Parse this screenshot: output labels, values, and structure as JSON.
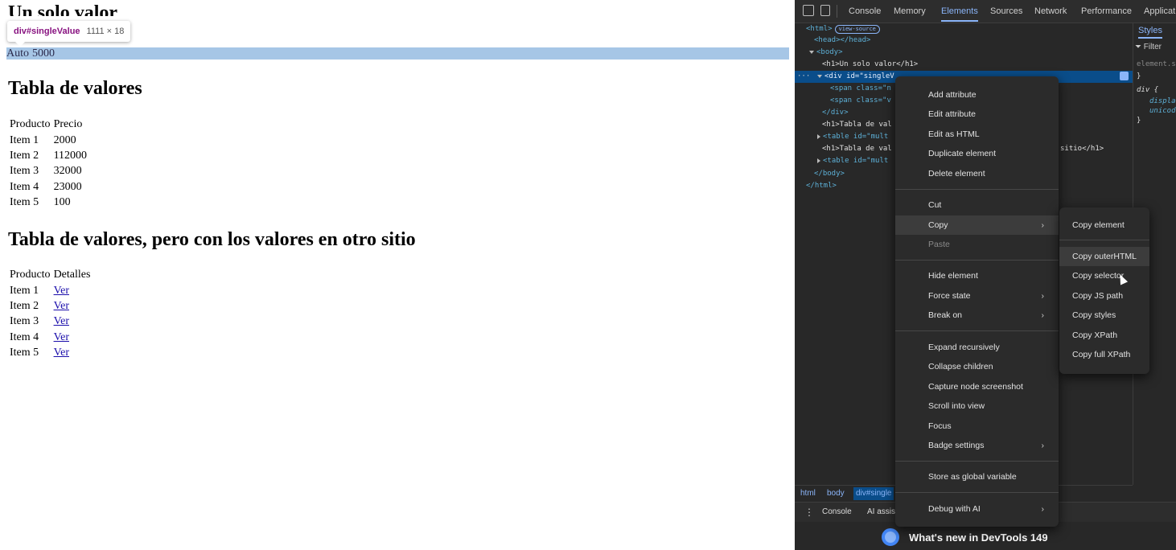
{
  "page": {
    "h1_single": "Un solo valor",
    "single_value": {
      "label": "Auto",
      "value": "5000"
    },
    "tooltip": {
      "selector": "div#singleValue",
      "size": "1111 × 18"
    },
    "h1_table1": "Tabla de valores",
    "table1": {
      "headers": [
        "Producto",
        "Precio"
      ],
      "rows": [
        [
          "Item 1",
          "2000"
        ],
        [
          "Item 2",
          "112000"
        ],
        [
          "Item 3",
          "32000"
        ],
        [
          "Item 4",
          "23000"
        ],
        [
          "Item 5",
          "100"
        ]
      ]
    },
    "h1_table2": "Tabla de valores, pero con los valores en otro sitio",
    "table2": {
      "headers": [
        "Producto",
        "Detalles"
      ],
      "rows": [
        [
          "Item 1",
          "Ver"
        ],
        [
          "Item 2",
          "Ver"
        ],
        [
          "Item 3",
          "Ver"
        ],
        [
          "Item 4",
          "Ver"
        ],
        [
          "Item 5",
          "Ver"
        ]
      ]
    }
  },
  "devtools": {
    "tabs": [
      "Console",
      "Memory",
      "Elements",
      "Sources",
      "Network",
      "Performance",
      "Applicat"
    ],
    "active_tab": "Elements",
    "dom": {
      "html_open": "<html>",
      "view_source": "view-source",
      "head": "<head></head>",
      "body_open": "<body>",
      "h1_1": "<h1>Un solo valor</h1>",
      "div_open": "<div id=\"singleV",
      "span1": "<span class=\"n",
      "span2": "<span class=\"v",
      "div_close": "</div>",
      "h1_2": "<h1>Tabla de val",
      "table1": "<table id=\"mult",
      "h1_3": "<h1>Tabla de val",
      "h1_3_tail": "sitio</h1>",
      "table2": "<table id=\"mult",
      "body_close": "</body>",
      "html_close": "</html>",
      "ellipsis": "···"
    },
    "styles": {
      "tab": "Styles",
      "filter": "Filter",
      "element_style": "element.s",
      "brace": "}",
      "div_rule": "div {",
      "prop1": "displa",
      "prop2": "unicod",
      "close": "}"
    },
    "breadcrumbs": [
      "html",
      "body",
      "div#single"
    ],
    "drawer": {
      "console": "Console",
      "ai": "AI assis"
    },
    "whats_new": "What's new in DevTools 149"
  },
  "context_menu": {
    "items": {
      "add_attribute": "Add attribute",
      "edit_attribute": "Edit attribute",
      "edit_html": "Edit as HTML",
      "duplicate": "Duplicate element",
      "delete": "Delete element",
      "cut": "Cut",
      "copy": "Copy",
      "paste": "Paste",
      "hide": "Hide element",
      "force_state": "Force state",
      "break_on": "Break on",
      "expand": "Expand recursively",
      "collapse": "Collapse children",
      "capture": "Capture node screenshot",
      "scroll": "Scroll into view",
      "focus": "Focus",
      "badge": "Badge settings",
      "store": "Store as global variable",
      "debug_ai": "Debug with AI"
    },
    "arrow": "›"
  },
  "copy_submenu": {
    "copy_element": "Copy element",
    "copy_outer": "Copy outerHTML",
    "copy_selector": "Copy selector",
    "copy_js": "Copy JS path",
    "copy_styles": "Copy styles",
    "copy_xpath": "Copy XPath",
    "copy_full_xpath": "Copy full XPath"
  }
}
